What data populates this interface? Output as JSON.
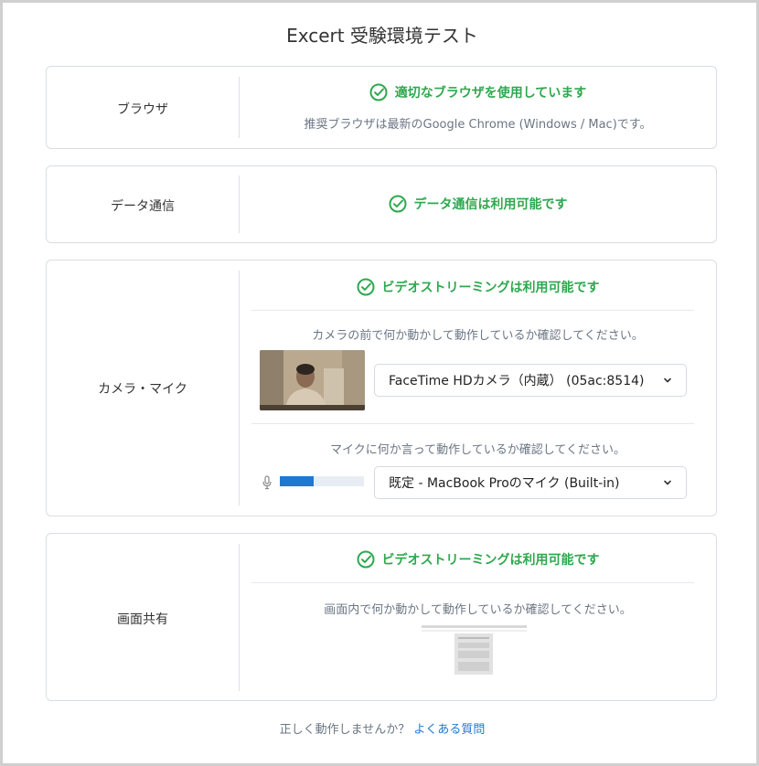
{
  "page": {
    "title": "Excert 受験環境テスト"
  },
  "colors": {
    "success": "#2ea84f",
    "link": "#1f78d1",
    "border": "#d9dde3"
  },
  "browser": {
    "label": "ブラウザ",
    "status": "適切なブラウザを使用しています",
    "note": "推奨ブラウザは最新のGoogle Chrome (Windows / Mac)です。"
  },
  "network": {
    "label": "データ通信",
    "status": "データ通信は利用可能です"
  },
  "camera_mic": {
    "label": "カメラ・マイク",
    "status": "ビデオストリーミングは利用可能です",
    "camera_instruction": "カメラの前で何か動かして動作しているか確認してください。",
    "camera_select": "FaceTime HDカメラ（内蔵） (05ac:8514)",
    "mic_instruction": "マイクに何か言って動作しているか確認してください。",
    "mic_select": "既定 - MacBook Proのマイク (Built-in)",
    "mic_level": 0.4
  },
  "screen_share": {
    "label": "画面共有",
    "status": "ビデオストリーミングは利用可能です",
    "instruction": "画面内で何か動かして動作しているか確認してください。"
  },
  "footer": {
    "question": "正しく動作しませんか？",
    "link": "よくある質問"
  },
  "icons": {
    "check": "check-circle-icon",
    "chevron": "chevron-down-icon",
    "mic": "microphone-icon"
  }
}
